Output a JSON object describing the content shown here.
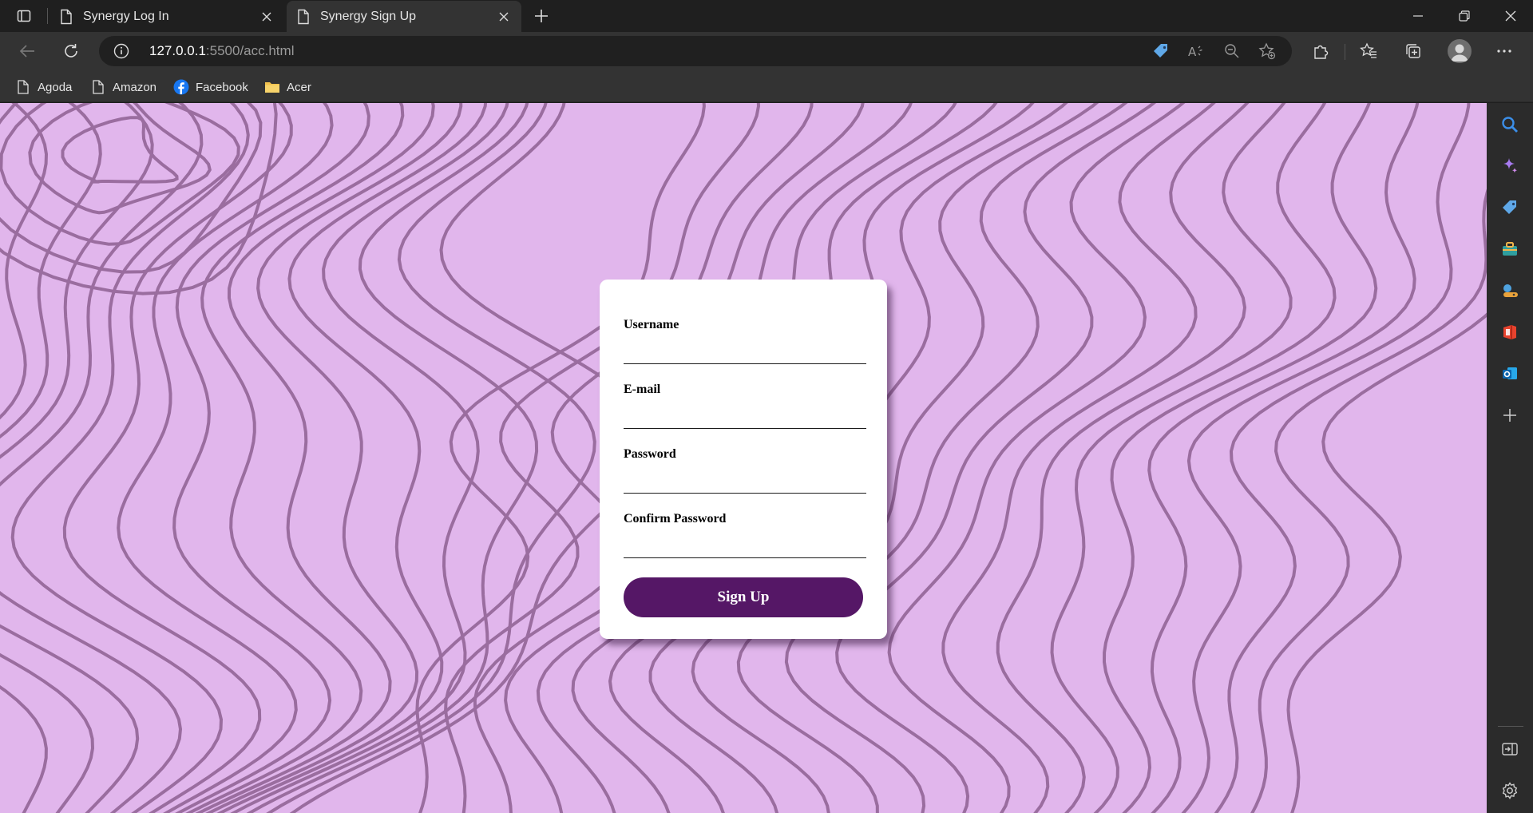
{
  "tabs": [
    {
      "title": "Synergy Log In",
      "active": false
    },
    {
      "title": "Synergy Sign Up",
      "active": true
    }
  ],
  "address": {
    "host": "127.0.0.1",
    "path": ":5500/acc.html"
  },
  "bookmarks": [
    {
      "label": "Agoda",
      "icon": "page-icon"
    },
    {
      "label": "Amazon",
      "icon": "page-icon"
    },
    {
      "label": "Facebook",
      "icon": "facebook-icon"
    },
    {
      "label": "Acer",
      "icon": "folder-icon"
    }
  ],
  "form": {
    "username_label": "Username",
    "email_label": "E-mail",
    "password_label": "Password",
    "confirm_label": "Confirm Password",
    "username_value": "",
    "email_value": "",
    "password_value": "",
    "confirm_value": "",
    "submit_label": "Sign Up"
  },
  "colors": {
    "page_background": "#e1b6ec",
    "contour_lines": "#9a6d9f",
    "button": "#551766",
    "browser_chrome": "#333333"
  },
  "sidebar": [
    "search-icon",
    "copilot-icon",
    "shopping-tag-icon",
    "tools-icon",
    "games-icon",
    "office-icon",
    "outlook-icon",
    "add-icon",
    "split-screen-icon",
    "settings-icon"
  ]
}
